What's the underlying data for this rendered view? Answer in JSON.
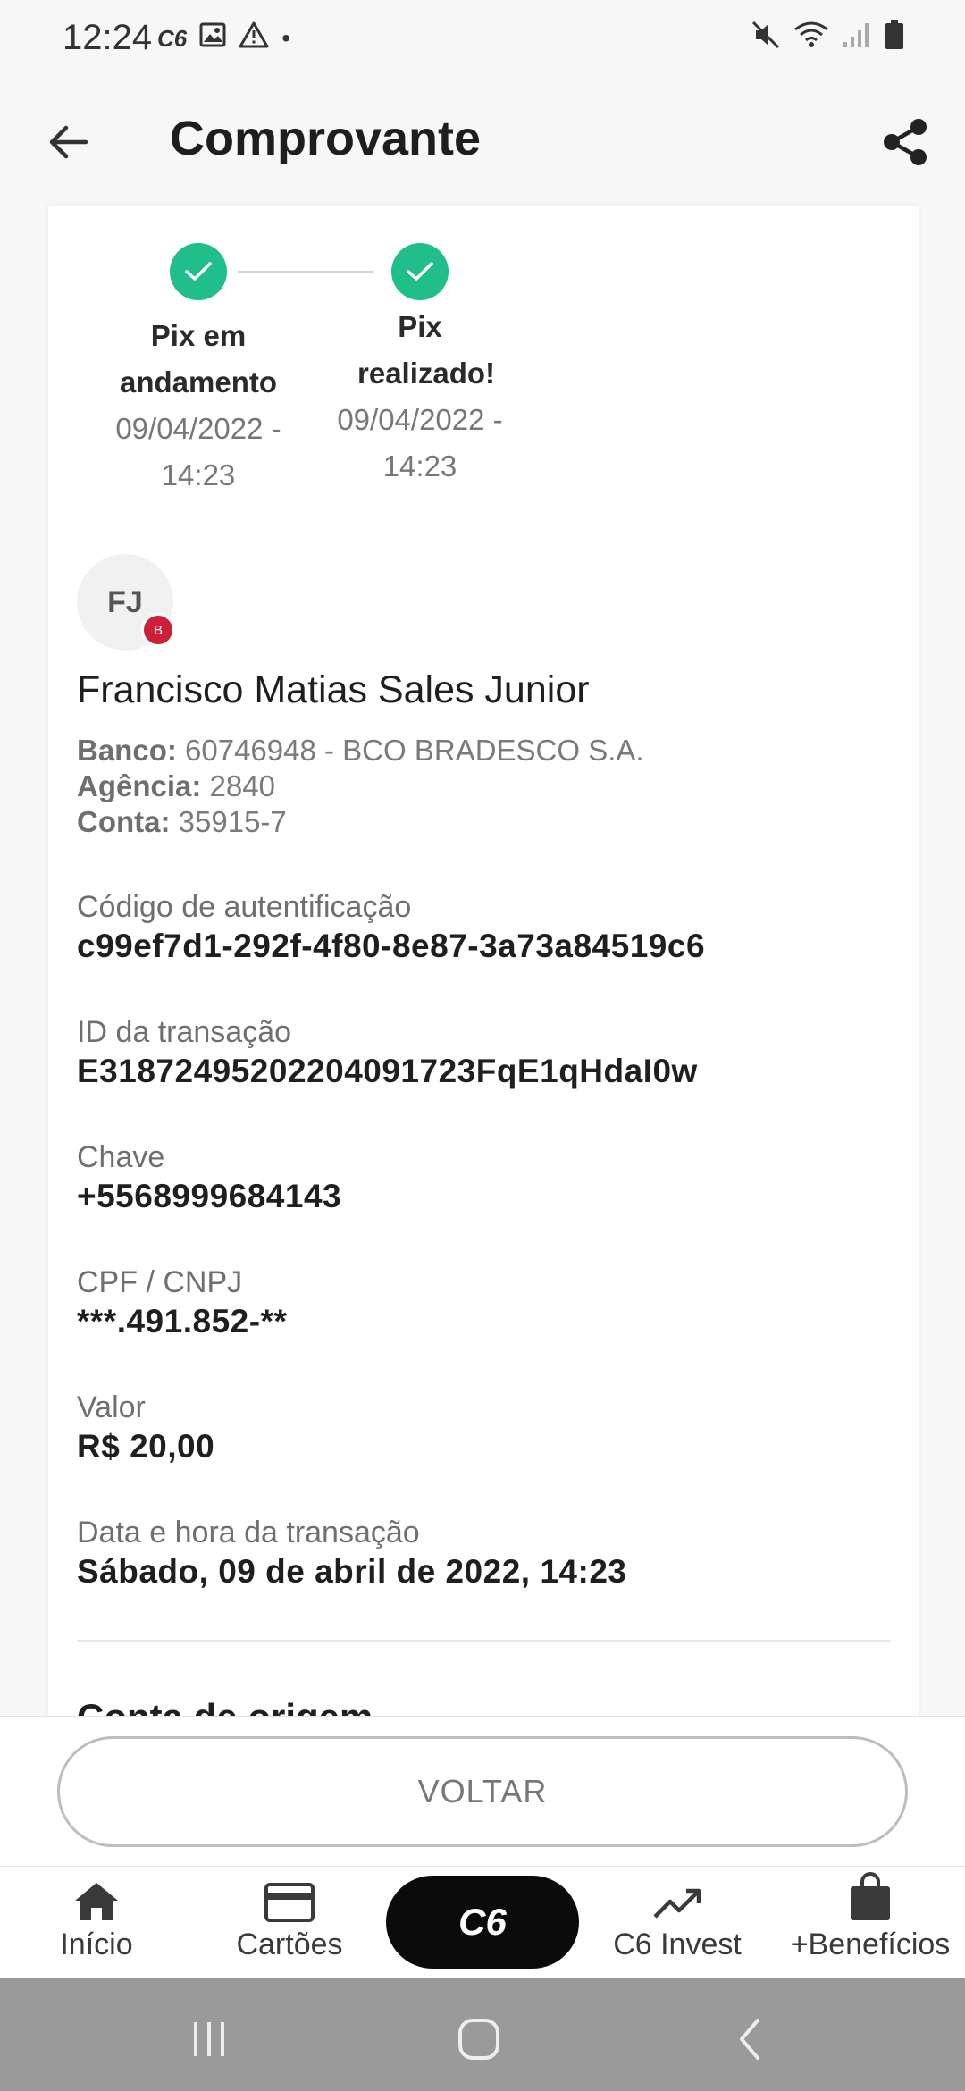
{
  "status_bar": {
    "time": "12:24",
    "carrier_mark": "C6",
    "icons": [
      "c6-app-icon",
      "gallery-icon",
      "warning-icon",
      "notification-dot",
      "mute-icon",
      "wifi-icon",
      "signal-icon",
      "battery-icon"
    ]
  },
  "header": {
    "title": "Comprovante",
    "back_icon": "arrow-left-icon",
    "share_icon": "share-icon"
  },
  "steps": [
    {
      "title": "Pix em andamento",
      "date": "09/04/2022 - 14:23"
    },
    {
      "title": "Pix realizado!",
      "date": "09/04/2022 - 14:23"
    }
  ],
  "recipient": {
    "initials": "FJ",
    "bank_badge": "B",
    "name": "Francisco Matias Sales Junior",
    "bank_label": "Banco:",
    "bank_value": "60746948 - BCO BRADESCO S.A.",
    "agency_label": "Agência:",
    "agency_value": "2840",
    "account_label": "Conta:",
    "account_value": "35915-7"
  },
  "fields": {
    "auth_code": {
      "label": "Código de autentificação",
      "value": "c99ef7d1-292f-4f80-8e87-3a73a84519c6"
    },
    "transaction_id": {
      "label": "ID da transação",
      "value": "E31872495202204091723FqE1qHdaI0w"
    },
    "key": {
      "label": "Chave",
      "value": "+5568999684143"
    },
    "cpf_cnpj": {
      "label": "CPF / CNPJ",
      "value": "***.491.852-**"
    },
    "amount": {
      "label": "Valor",
      "value": "R$ 20,00"
    },
    "datetime": {
      "label": "Data e hora da transação",
      "value": "Sábado, 09 de abril de 2022, 14:23"
    }
  },
  "section": {
    "origin_title": "Conta de origem"
  },
  "actions": {
    "voltar": "VOLTAR"
  },
  "bottom_nav": {
    "items": [
      {
        "label": "Início",
        "icon": "home-icon"
      },
      {
        "label": "Cartões",
        "icon": "card-icon"
      },
      {
        "label": "C6",
        "icon": "c6-logo"
      },
      {
        "label": "C6 Invest",
        "icon": "trending-up-icon"
      },
      {
        "label": "+Benefícios",
        "icon": "shopping-bag-icon"
      }
    ]
  },
  "colors": {
    "success": "#1fbe8a",
    "badge": "#cc1f3a",
    "center_nav": "#0b0b0b"
  }
}
